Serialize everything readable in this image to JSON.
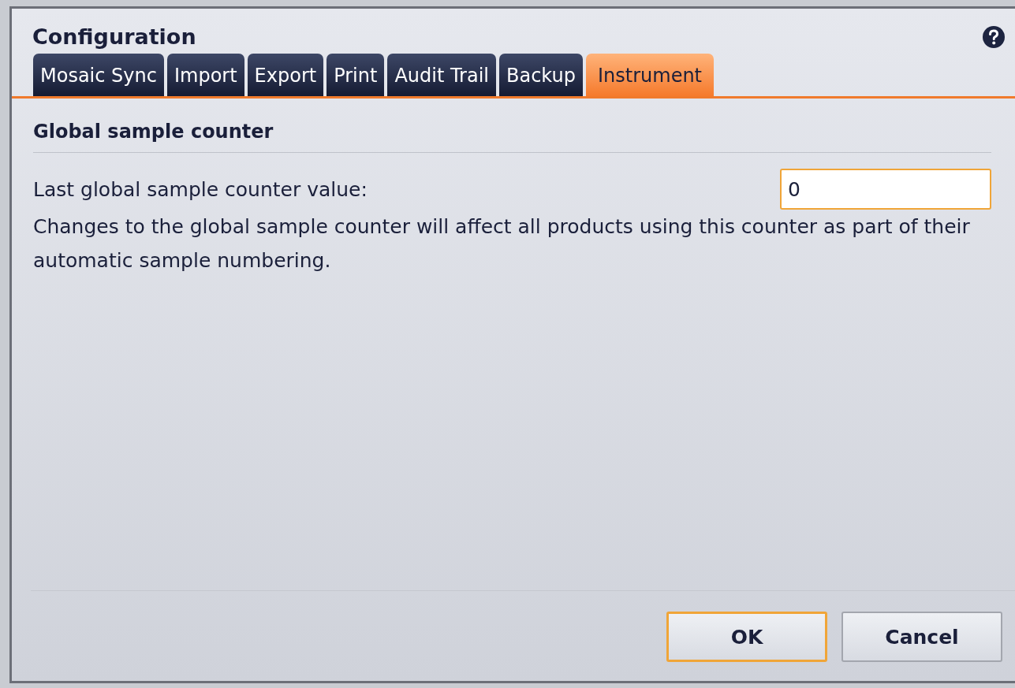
{
  "window": {
    "title": "Configuration"
  },
  "tabs": [
    {
      "label": "Mosaic Sync",
      "selected": false
    },
    {
      "label": "Import",
      "selected": false
    },
    {
      "label": "Export",
      "selected": false
    },
    {
      "label": "Print",
      "selected": false
    },
    {
      "label": "Audit Trail",
      "selected": false
    },
    {
      "label": "Backup",
      "selected": false
    },
    {
      "label": "Instrument",
      "selected": true
    }
  ],
  "section": {
    "heading": "Global sample counter"
  },
  "field": {
    "label": "Last global sample counter value:",
    "value": "0",
    "focused": true
  },
  "note": "Changes to the global sample counter will affect all products using this counter as part of their automatic sample numbering.",
  "buttons": [
    {
      "label": "OK",
      "default": true
    },
    {
      "label": "Cancel",
      "default": false
    }
  ]
}
